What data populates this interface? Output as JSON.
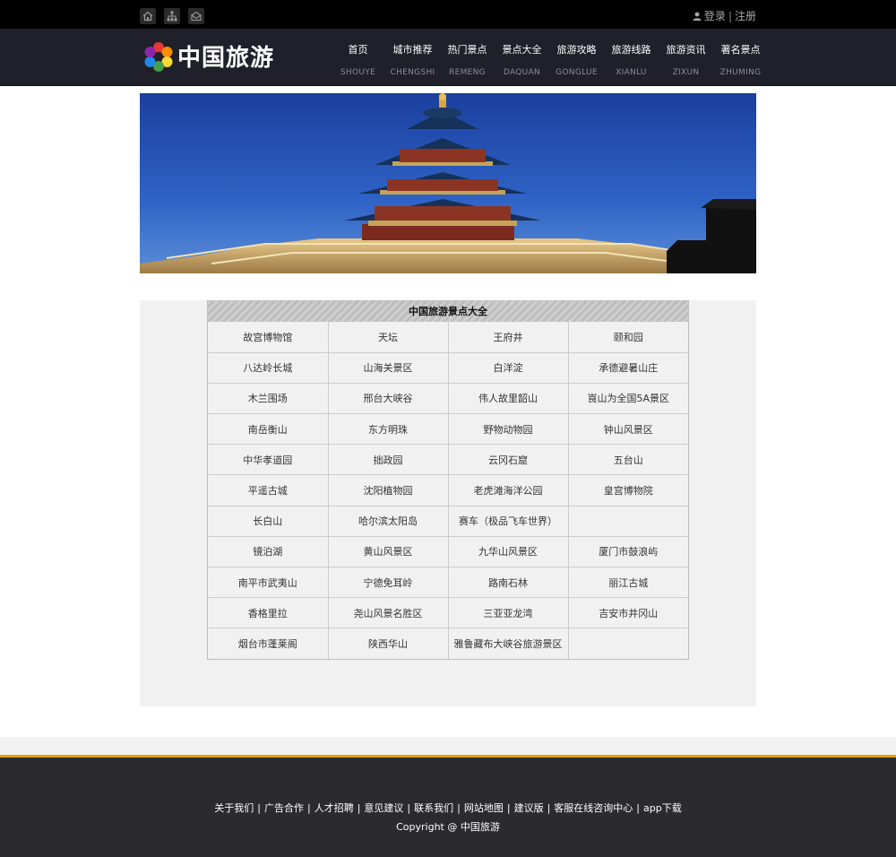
{
  "topbar": {
    "icons": [
      "home-icon",
      "sitemap-icon",
      "mail-icon"
    ],
    "login_label": "登录",
    "separator": "|",
    "register_label": "注册"
  },
  "header": {
    "brand": "中国旅游",
    "nav": [
      {
        "cn": "首页",
        "en": "SHOUYE"
      },
      {
        "cn": "城市推荐",
        "en": "CHENGSHI"
      },
      {
        "cn": "热门景点",
        "en": "REMENG"
      },
      {
        "cn": "景点大全",
        "en": "DAQUAN"
      },
      {
        "cn": "旅游攻略",
        "en": "GONGLUE"
      },
      {
        "cn": "旅游线路",
        "en": "XIANLU"
      },
      {
        "cn": "旅游资讯",
        "en": "ZIXUN"
      },
      {
        "cn": "著名景点",
        "en": "ZHUMING"
      }
    ]
  },
  "table": {
    "title": "中国旅游景点大全",
    "rows": [
      [
        "故宫博物馆",
        "天坛",
        "王府井",
        "颐和园"
      ],
      [
        "八达岭长城",
        "山海关景区",
        "白洋淀",
        "承德避暑山庄"
      ],
      [
        "木兰围场",
        "邢台大峡谷",
        "伟人故里韶山",
        "崀山为全国5A景区"
      ],
      [
        "南岳衡山",
        "东方明珠",
        "野物动物园",
        "钟山风景区"
      ],
      [
        "中华孝道园",
        "拙政园",
        "云冈石窟",
        "五台山"
      ],
      [
        "平遥古城",
        "沈阳植物园",
        "老虎滩海洋公园",
        "皇宫博物院"
      ],
      [
        "长白山",
        "哈尔滨太阳岛",
        "赛车（极品飞车世界）",
        ""
      ],
      [
        "镜泊湖",
        "黄山风景区",
        "九华山风景区",
        "厦门市鼓浪屿"
      ],
      [
        "南平市武夷山",
        "宁德免耳岭",
        "路南石林",
        "丽江古城"
      ],
      [
        "香格里拉",
        "尧山风景名胜区",
        "三亚亚龙湾",
        "吉安市井冈山"
      ],
      [
        "烟台市蓬莱阁",
        "陕西华山",
        "雅鲁藏布大峡谷旅游景区",
        ""
      ]
    ]
  },
  "footer": {
    "links": [
      "关于我们",
      "广告合作",
      "人才招聘",
      "意见建议",
      "联系我们",
      "网站地图",
      "建议版",
      "客服在线咨询中心",
      "app下载"
    ],
    "copyright": "Copyright @ 中国旅游"
  },
  "colors": {
    "topbar_bg": "#000000",
    "header_bg": "#1f2029",
    "footer_bg": "#2b2b2d",
    "footer_accent": "#e5a300",
    "content_bg": "#f1f1f1"
  }
}
